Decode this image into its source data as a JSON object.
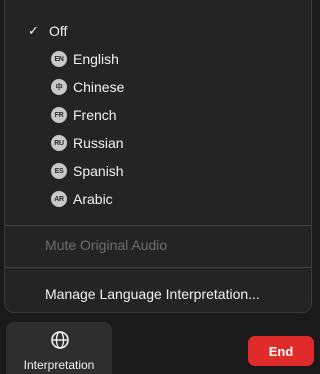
{
  "menu": {
    "off_check": "✓",
    "off_label": "Off",
    "languages": [
      {
        "code": "EN",
        "label": "English"
      },
      {
        "code": "中",
        "label": "Chinese"
      },
      {
        "code": "FR",
        "label": "French"
      },
      {
        "code": "RU",
        "label": "Russian"
      },
      {
        "code": "ES",
        "label": "Spanish"
      },
      {
        "code": "AR",
        "label": "Arabic"
      }
    ],
    "mute_label": "Mute Original Audio",
    "manage_label": "Manage Language Interpretation..."
  },
  "toolbar": {
    "interpretation_label": "Interpretation",
    "interpretation_icon": "globe-icon",
    "end_label": "End"
  },
  "colors": {
    "background": "#1a1a1a",
    "menu_bg": "#242424",
    "end_red": "#e02b2b"
  }
}
